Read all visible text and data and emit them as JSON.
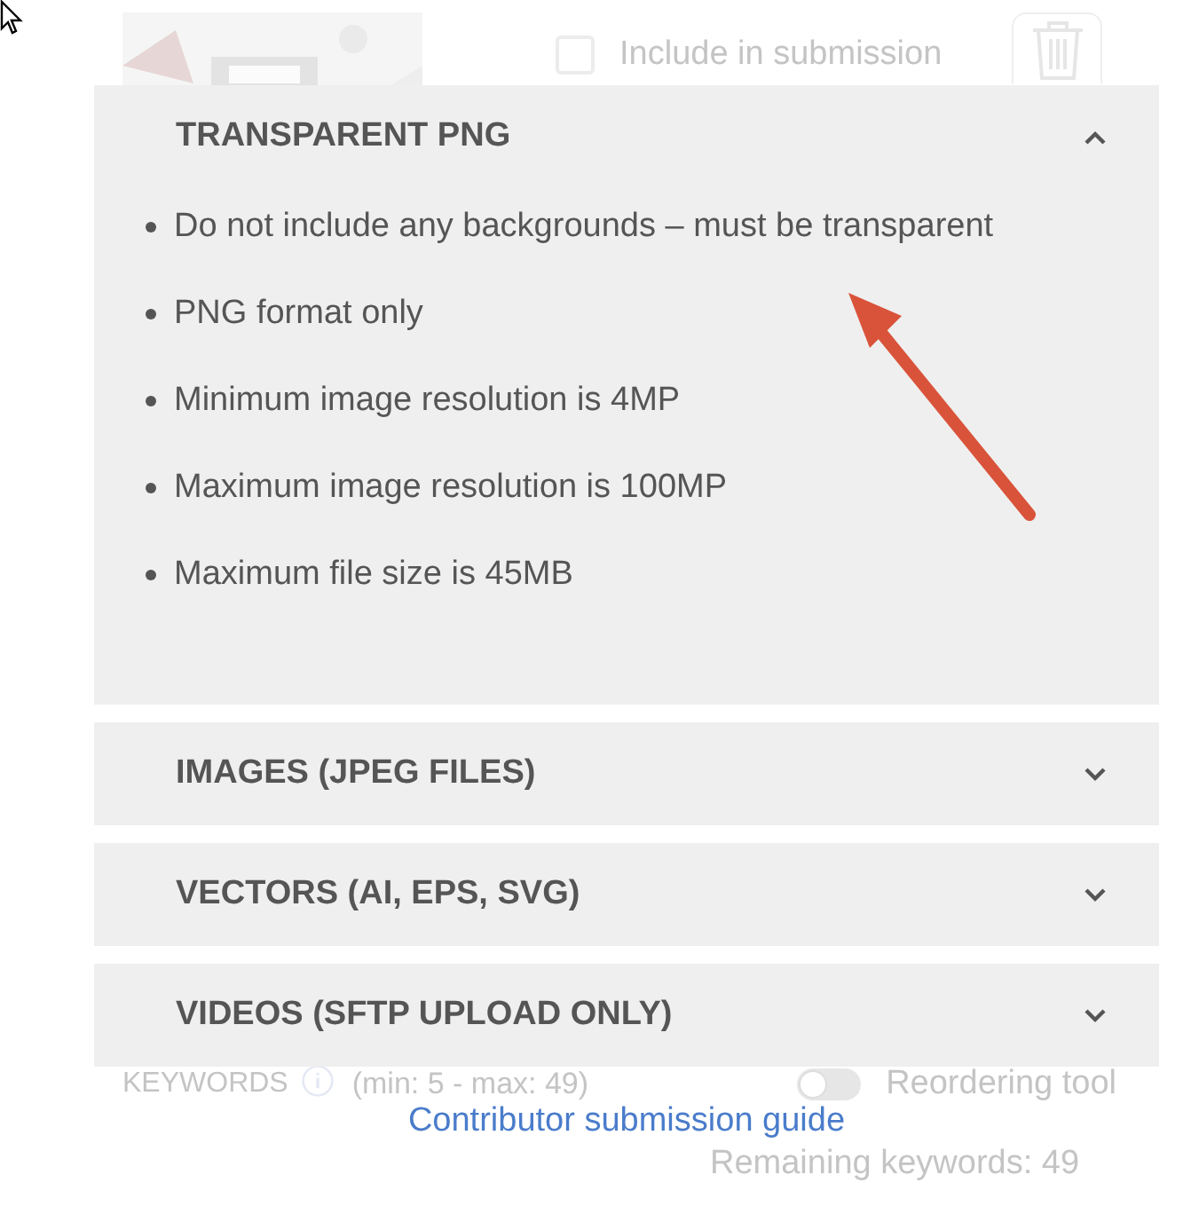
{
  "background": {
    "include_checkbox": {
      "label": "Include in submission",
      "checked": false
    },
    "keywords": {
      "label": "KEYWORDS",
      "hint": "(min: 5 - max: 49)"
    },
    "reordering_toggle": {
      "label": "Reordering tool",
      "on": false
    },
    "remaining": "Remaining keywords: 49"
  },
  "accordion": {
    "sections": [
      {
        "title": "TRANSPARENT PNG",
        "expanded": true,
        "items": [
          "Do not include any backgrounds – must be transparent",
          "PNG format only",
          "Minimum image resolution is 4MP",
          "Maximum image resolution is 100MP",
          "Maximum file size is 45MB"
        ]
      },
      {
        "title": "IMAGES (JPEG FILES)",
        "expanded": false
      },
      {
        "title": "VECTORS (AI, EPS, SVG)",
        "expanded": false
      },
      {
        "title": "VIDEOS (SFTP UPLOAD ONLY)",
        "expanded": false
      }
    ],
    "guide_link": "Contributor submission guide"
  }
}
